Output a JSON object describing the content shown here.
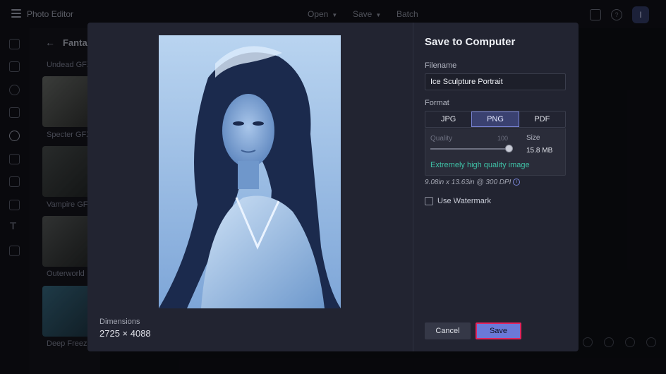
{
  "app": {
    "title": "Photo Editor",
    "menu": [
      {
        "label": "Open"
      },
      {
        "label": "Save"
      },
      {
        "label": "Batch"
      }
    ],
    "avatar_initial": "I"
  },
  "left_panel": {
    "title": "Fantasy",
    "items": [
      {
        "label": "Undead GFX"
      },
      {
        "label": "Specter GFX"
      },
      {
        "label": "Vampire GFX"
      },
      {
        "label": "Outerworld"
      },
      {
        "label": "Deep Freeze"
      }
    ]
  },
  "dialog": {
    "title": "Save to Computer",
    "filename_label": "Filename",
    "filename_value": "Ice Sculpture Portrait",
    "format_label": "Format",
    "formats": [
      {
        "label": "JPG"
      },
      {
        "label": "PNG"
      },
      {
        "label": "PDF"
      }
    ],
    "selected_format": "PNG",
    "quality_label": "Quality",
    "quality_value": "100",
    "size_label": "Size",
    "size_value": "15.8 MB",
    "quality_note": "Extremely high quality image",
    "dpi_text": "9.08in x 13.63in @ 300 DPI",
    "watermark_label": "Use Watermark",
    "watermark_checked": false,
    "dimensions_label": "Dimensions",
    "dimensions_value": "2725 × 4088",
    "cancel_label": "Cancel",
    "save_label": "Save"
  },
  "colors": {
    "accent": "#6b79d8",
    "highlight": "#e2245e",
    "quality_note": "#3fc1a6"
  }
}
